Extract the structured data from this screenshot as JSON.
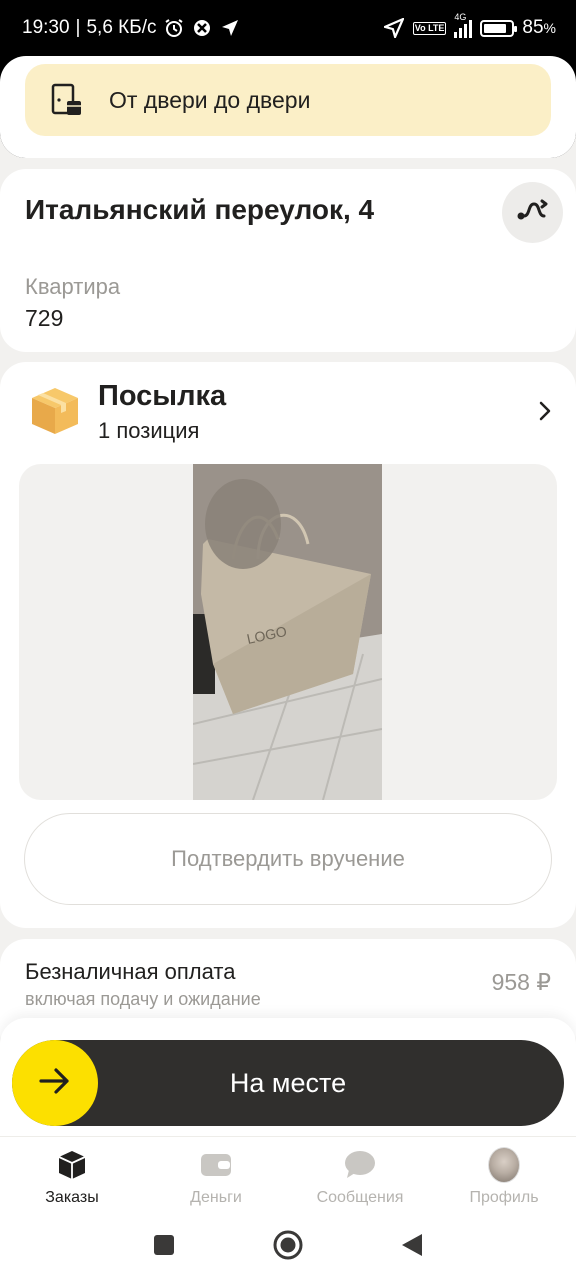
{
  "status_bar": {
    "time": "19:30",
    "speed": "5,6 КБ/с",
    "network": "4G",
    "lte": "Vo LTE",
    "battery_text": "85",
    "battery_unit": "%",
    "battery_level": 0.85
  },
  "delivery": {
    "mode_label": "От двери до двери",
    "icon": "door-parcel-icon"
  },
  "address": {
    "title": "Итальянский переулок, 4",
    "apartment_label": "Квартира",
    "apartment_value": "729",
    "route_icon": "route-icon"
  },
  "parcel": {
    "title": "Посылка",
    "subtitle": "1 позиция",
    "icon": "box-icon",
    "confirm_label": "Подтвердить вручение"
  },
  "payment": {
    "title": "Безналичная оплата",
    "subtitle": "включая подачу и ожидание",
    "price": "958 ₽"
  },
  "action": {
    "label": "На месте",
    "knob_icon": "arrow-right-icon"
  },
  "tabs": [
    {
      "label": "Заказы",
      "icon": "orders-icon",
      "active": true
    },
    {
      "label": "Деньги",
      "icon": "wallet-icon",
      "active": false
    },
    {
      "label": "Сообщения",
      "icon": "chat-icon",
      "active": false
    },
    {
      "label": "Профиль",
      "icon": "avatar",
      "active": false
    }
  ],
  "colors": {
    "accent": "#fce000",
    "pill_bg": "#fbefc7",
    "dark": "#302f2d"
  }
}
